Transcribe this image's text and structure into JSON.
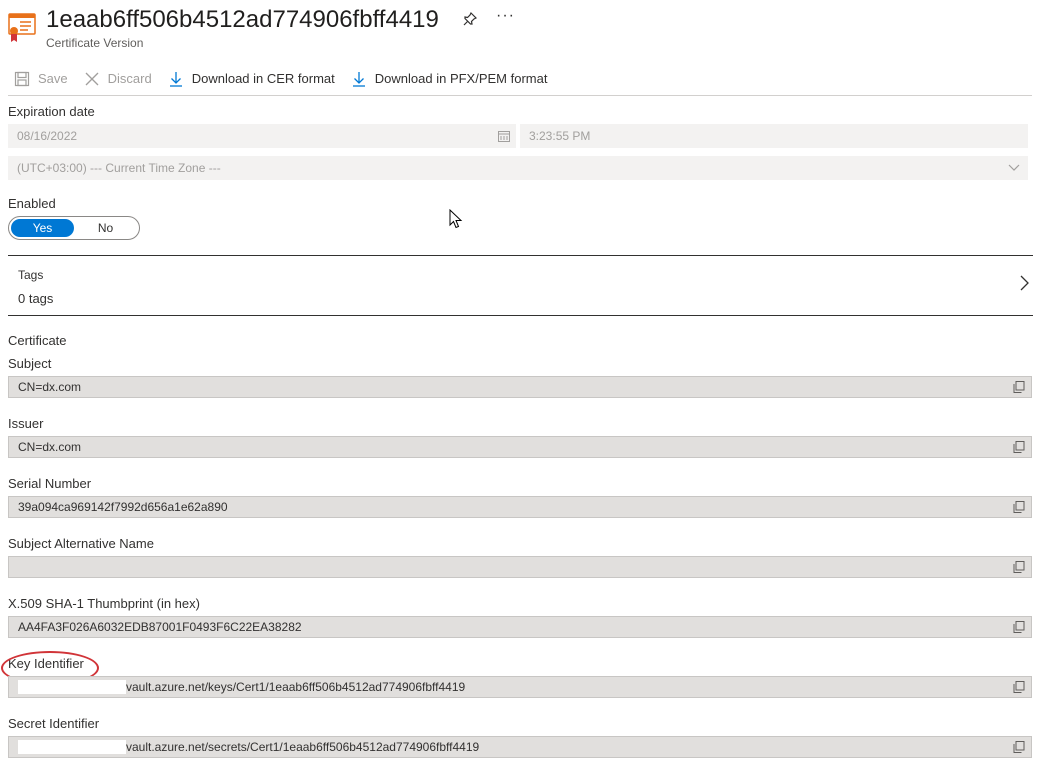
{
  "header": {
    "title": "1eaab6ff506b4512ad774906fbff4419",
    "subtitle": "Certificate Version",
    "more": "···"
  },
  "toolbar": {
    "save_label": "Save",
    "discard_label": "Discard",
    "download_cer_label": "Download in CER format",
    "download_pfx_label": "Download in PFX/PEM format"
  },
  "expiration": {
    "label": "Expiration date",
    "date": "08/16/2022",
    "time": "3:23:55 PM",
    "timezone": "(UTC+03:00) --- Current Time Zone ---"
  },
  "enabled": {
    "label": "Enabled",
    "yes": "Yes",
    "no": "No",
    "selected": "Yes"
  },
  "tags": {
    "label": "Tags",
    "value": "0 tags"
  },
  "certificate": {
    "section_label": "Certificate",
    "fields": [
      {
        "label": "Subject",
        "value": "CN=dx.com"
      },
      {
        "label": "Issuer",
        "value": "CN=dx.com"
      },
      {
        "label": "Serial Number",
        "value": "39a094ca969142f7992d656a1e62a890"
      },
      {
        "label": "Subject Alternative Name",
        "value": ""
      },
      {
        "label": "X.509 SHA-1 Thumbprint (in hex)",
        "value": "AA4FA3F026A6032EDB87001F0493F6C22EA38282"
      },
      {
        "label": "Key Identifier",
        "value": "vault.azure.net/keys/Cert1/1eaab6ff506b4512ad774906fbff4419"
      },
      {
        "label": "Secret Identifier",
        "value": "vault.azure.net/secrets/Cert1/1eaab6ff506b4512ad774906fbff4419"
      }
    ]
  },
  "colors": {
    "accent": "#0078d4",
    "annotation": "#d13438",
    "cert_icon": "#e8711a"
  },
  "icons": [
    "certificate-icon",
    "pin-icon",
    "more-icon",
    "save-icon",
    "discard-icon",
    "download-icon",
    "calendar-icon",
    "chevron-down-icon",
    "chevron-right-icon",
    "copy-icon",
    "mouse-cursor-icon"
  ]
}
